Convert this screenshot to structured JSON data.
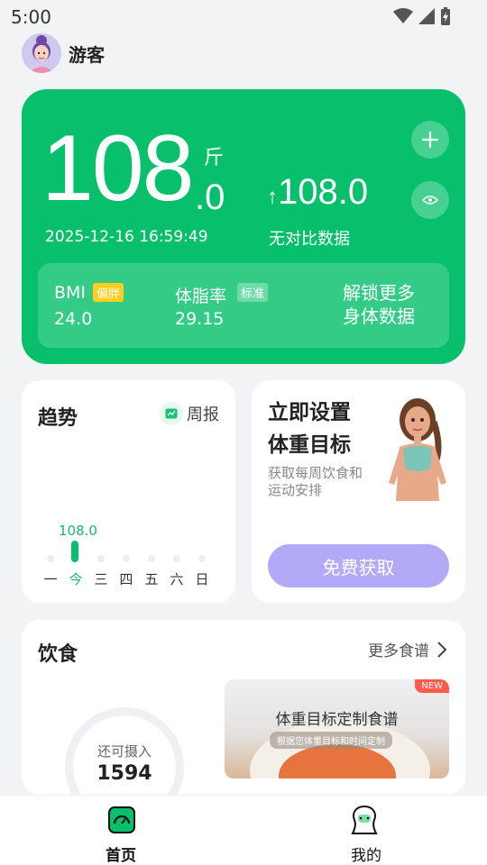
{
  "status_bar": {
    "time": "5:00"
  },
  "header": {
    "user_name": "游客"
  },
  "weight_card": {
    "weight_int": "108",
    "weight_dec": ".0",
    "unit": "斤",
    "timestamp": "2025-12-16 16:59:49",
    "compare_arrow": "↑",
    "compare_value": "108.0",
    "compare_text": "无对比数据",
    "bmi_label": "BMI",
    "bmi_badge": "偏胖",
    "bmi_value": "24.0",
    "fat_label": "体脂率",
    "fat_badge": "标准",
    "fat_value": "29.15",
    "unlock_text_1": "解锁更多",
    "unlock_text_2": "身体数据"
  },
  "trend": {
    "title": "趋势",
    "weekly_label": "周报",
    "value_label": "108.0",
    "days": [
      "一",
      "今",
      "三",
      "四",
      "五",
      "六",
      "日"
    ],
    "active_index": 1
  },
  "goal": {
    "title_1": "立即设置",
    "title_2": "体重目标",
    "sub_1": "获取每周饮食和",
    "sub_2": "运动安排",
    "button": "免费获取"
  },
  "diet": {
    "title": "饮食",
    "more": "更多食谱",
    "remaining_label": "还可摄入",
    "remaining_value": "1594",
    "recipe_title": "体重目标定制食谱",
    "recipe_sub": "根据您体重目标和时间定制",
    "new_badge": "NEW"
  },
  "bottom_nav": {
    "home": "首页",
    "mine": "我的"
  },
  "colors": {
    "accent": "#08c06c",
    "goal_button": "#b2aaf6",
    "badge_yellow": "#ffce1f"
  }
}
